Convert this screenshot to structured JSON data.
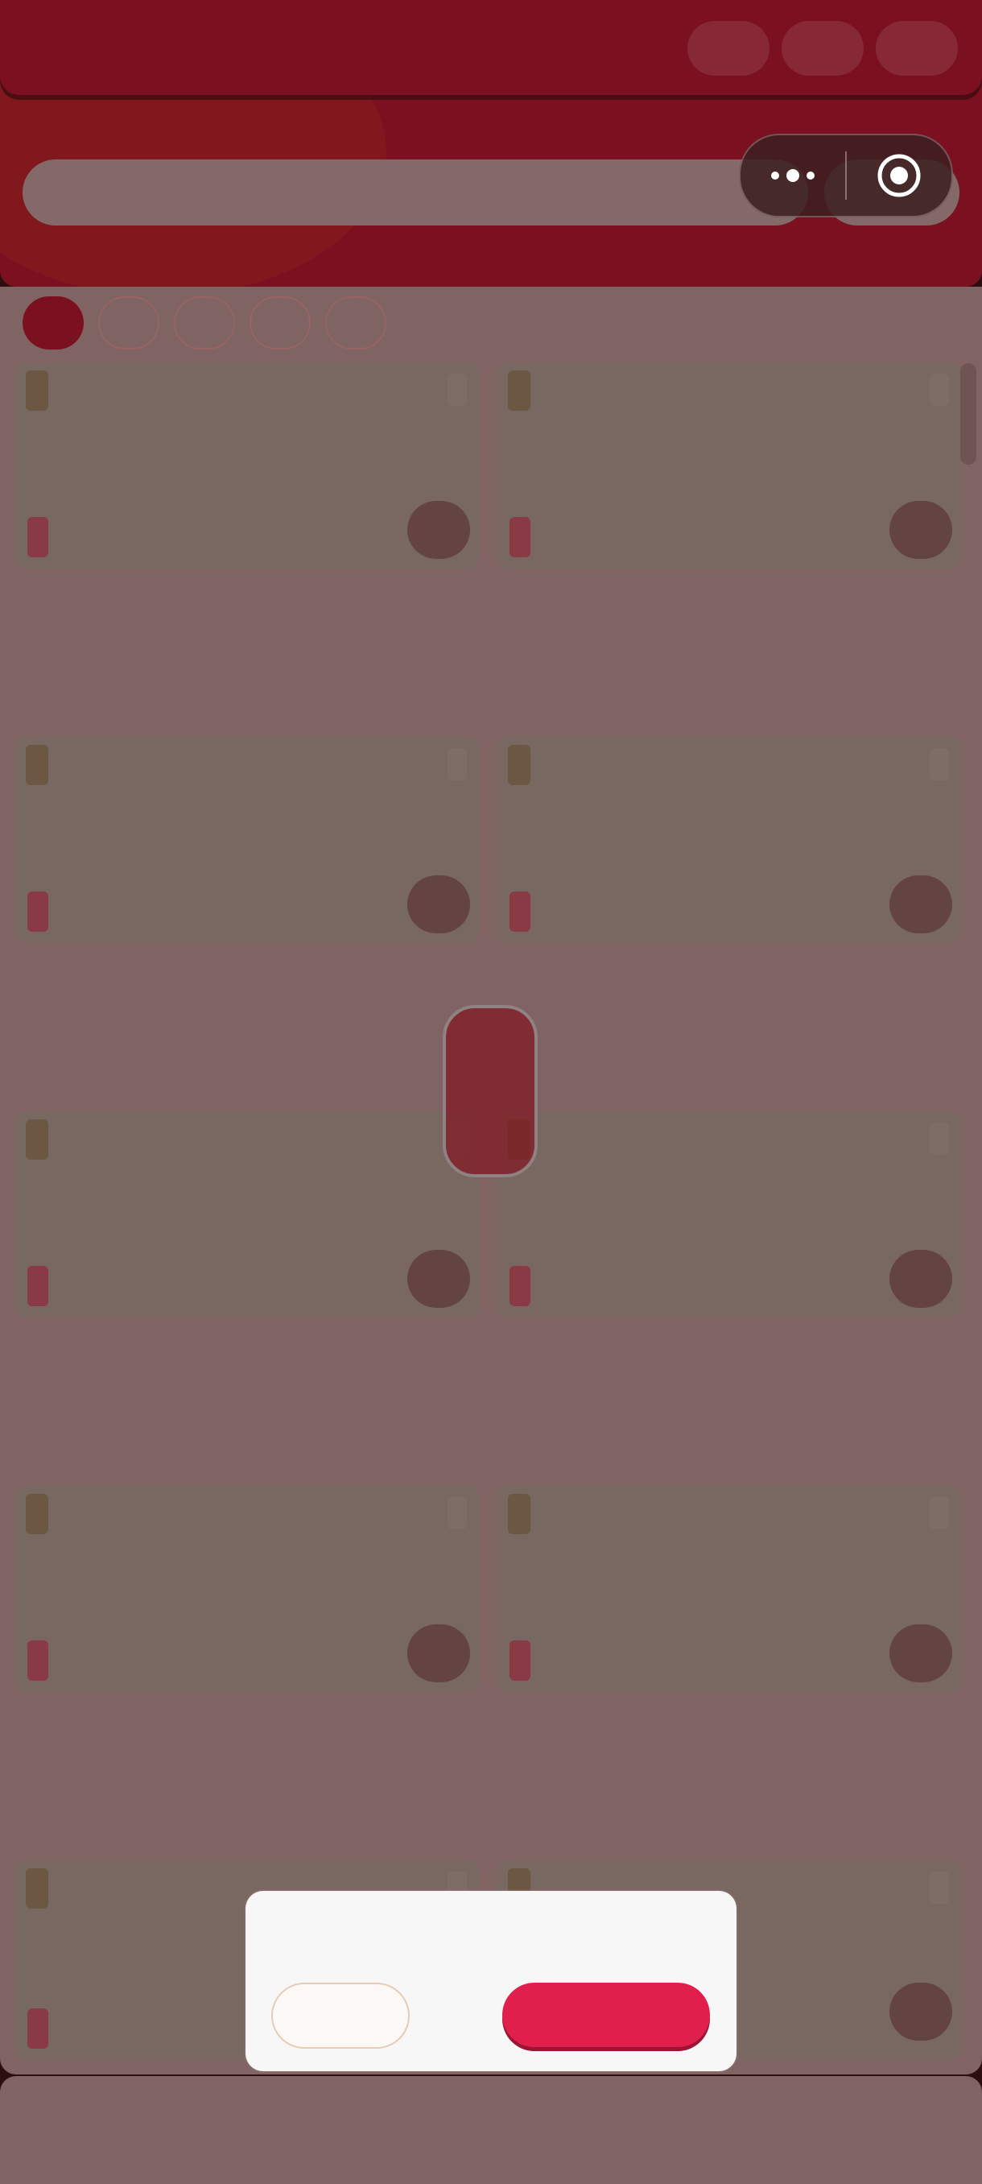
{
  "header": {
    "search": {
      "placeholder": ""
    },
    "capsule": {
      "more_icon": "more-dots-icon",
      "target_icon": "target-icon"
    }
  },
  "tabs": [
    {
      "label": "",
      "active": true
    },
    {
      "label": "",
      "active": false
    },
    {
      "label": "",
      "active": false
    },
    {
      "label": "",
      "active": false
    },
    {
      "label": "",
      "active": false
    }
  ],
  "products": [
    {
      "title": ""
    },
    {
      "title": ""
    },
    {
      "title": ""
    },
    {
      "title": ""
    },
    {
      "title": ""
    },
    {
      "title": ""
    },
    {
      "title": ""
    },
    {
      "title": ""
    },
    {
      "title": ""
    },
    {
      "title": ""
    }
  ],
  "dialog": {
    "cancel_label": "",
    "confirm_label": ""
  },
  "colors": {
    "brand": "#7a1020",
    "overlay_body": "#806463",
    "confirm": "#e11f4d",
    "cancel_border": "#e6cbb5",
    "dialog_bg": "#f8f7f7"
  }
}
